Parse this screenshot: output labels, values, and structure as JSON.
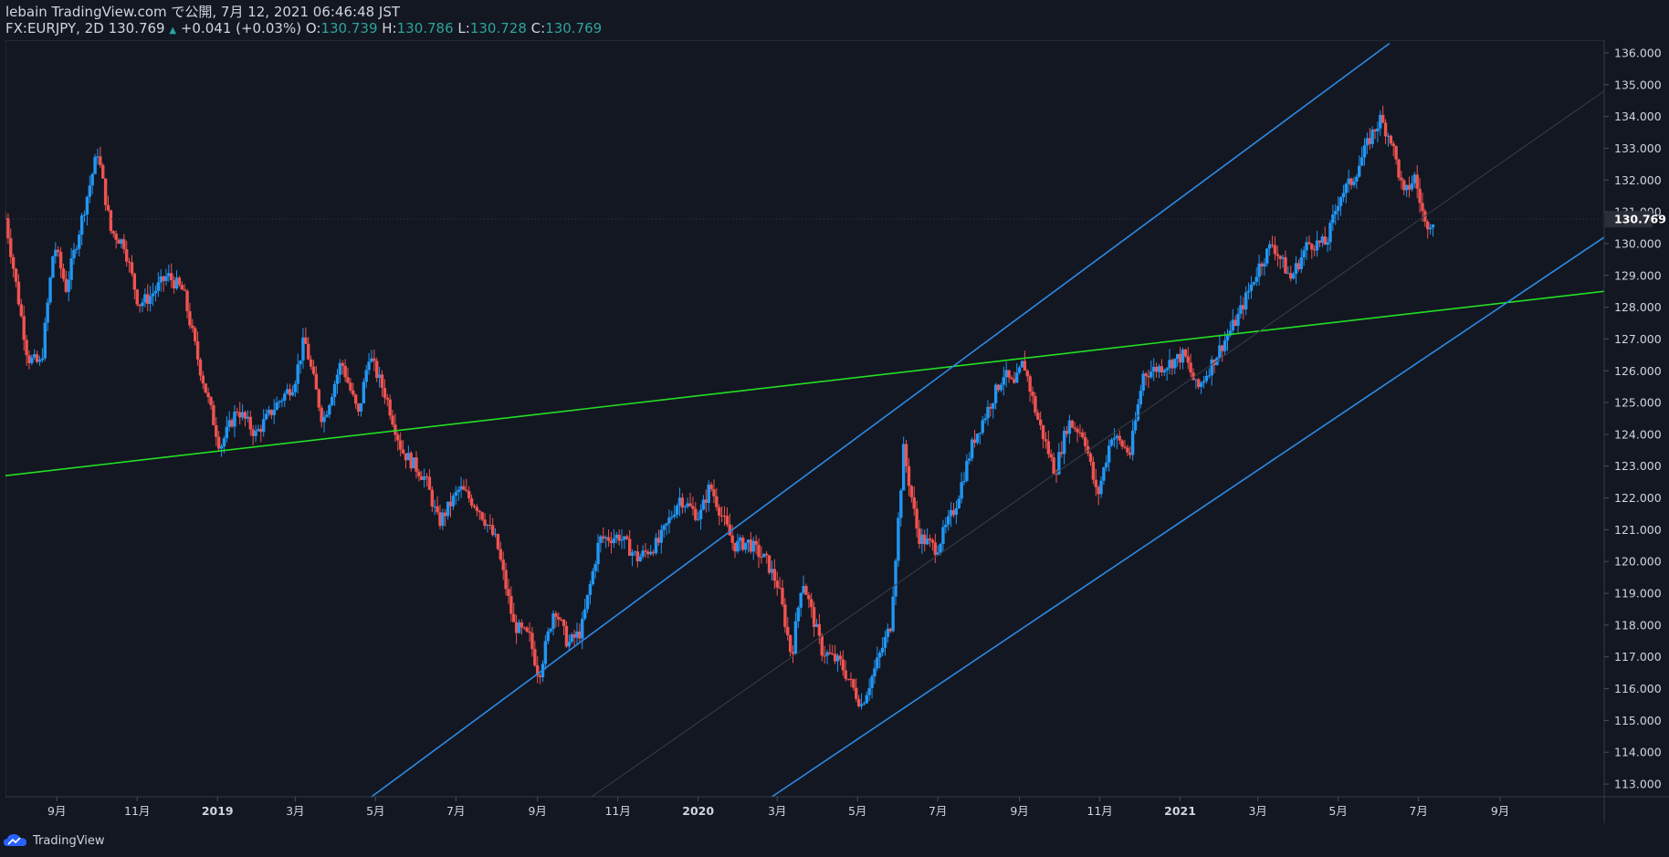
{
  "header": {
    "published": "lebain TradingView.com で公開, 7月 12, 2021 06:46:48 JST",
    "symbol": "FX:EURJPY, 2D",
    "last": "130.769",
    "change": "+0.041 (+0.03%)",
    "o_label": "O:",
    "o_value": "130.739",
    "h_label": "H:",
    "h_value": "130.786",
    "l_label": "L:",
    "l_value": "130.728",
    "c_label": "C:",
    "c_value": "130.769"
  },
  "footer": {
    "brand": "TradingView"
  },
  "colors": {
    "background": "#131722",
    "up": "#2196f3",
    "down": "#ef5350",
    "trendline_green": "#22e022",
    "channel_blue": "#2c8ae6",
    "grid": "#2a2e39",
    "axis_text": "#d1d4dc"
  },
  "chart_data": {
    "type": "candlestick",
    "symbol": "FX:EURJPY",
    "interval": "2D",
    "ylim": [
      112.6,
      136.4
    ],
    "y_ticks": [
      113,
      114,
      115,
      116,
      117,
      118,
      119,
      120,
      121,
      122,
      123,
      124,
      125,
      126,
      127,
      128,
      129,
      130,
      131,
      132,
      133,
      134,
      135,
      136
    ],
    "y_tick_labels": [
      "113.000",
      "114.000",
      "115.000",
      "116.000",
      "117.000",
      "118.000",
      "119.000",
      "120.000",
      "121.000",
      "122.000",
      "123.000",
      "124.000",
      "125.000",
      "126.000",
      "127.000",
      "128.000",
      "129.000",
      "130.000",
      "131.000",
      "132.000",
      "133.000",
      "134.000",
      "135.000",
      "136.000"
    ],
    "x_ticks": [
      {
        "label": "9月",
        "date": "2018-09-01"
      },
      {
        "label": "11月",
        "date": "2018-11-01"
      },
      {
        "label": "2019",
        "date": "2019-01-01"
      },
      {
        "label": "3月",
        "date": "2019-03-01"
      },
      {
        "label": "5月",
        "date": "2019-05-01"
      },
      {
        "label": "7月",
        "date": "2019-07-01"
      },
      {
        "label": "9月",
        "date": "2019-09-01"
      },
      {
        "label": "11月",
        "date": "2019-11-01"
      },
      {
        "label": "2020",
        "date": "2020-01-01"
      },
      {
        "label": "3月",
        "date": "2020-03-01"
      },
      {
        "label": "5月",
        "date": "2020-05-01"
      },
      {
        "label": "7月",
        "date": "2020-07-01"
      },
      {
        "label": "9月",
        "date": "2020-09-01"
      },
      {
        "label": "11月",
        "date": "2020-11-01"
      },
      {
        "label": "2021",
        "date": "2021-01-01"
      },
      {
        "label": "3月",
        "date": "2021-03-01"
      },
      {
        "label": "5月",
        "date": "2021-05-01"
      },
      {
        "label": "7月",
        "date": "2021-07-01"
      },
      {
        "label": "9月",
        "date": "2021-09-01"
      }
    ],
    "x_range": [
      "2018-07-24",
      "2021-11-19"
    ],
    "price_path": [
      {
        "date": "2018-07-24",
        "price": 130.8
      },
      {
        "date": "2018-08-10",
        "price": 126.4
      },
      {
        "date": "2018-08-20",
        "price": 126.2
      },
      {
        "date": "2018-08-30",
        "price": 130.0
      },
      {
        "date": "2018-09-08",
        "price": 128.6
      },
      {
        "date": "2018-09-24",
        "price": 131.5
      },
      {
        "date": "2018-10-02",
        "price": 132.9
      },
      {
        "date": "2018-10-12",
        "price": 130.4
      },
      {
        "date": "2018-10-22",
        "price": 130.0
      },
      {
        "date": "2018-11-02",
        "price": 128.1
      },
      {
        "date": "2018-11-10",
        "price": 128.3
      },
      {
        "date": "2018-11-24",
        "price": 129.0
      },
      {
        "date": "2018-12-06",
        "price": 128.5
      },
      {
        "date": "2018-12-18",
        "price": 126.2
      },
      {
        "date": "2019-01-03",
        "price": 123.6
      },
      {
        "date": "2019-01-16",
        "price": 124.8
      },
      {
        "date": "2019-01-30",
        "price": 124.0
      },
      {
        "date": "2019-02-14",
        "price": 124.9
      },
      {
        "date": "2019-02-28",
        "price": 125.6
      },
      {
        "date": "2019-03-08",
        "price": 127.0
      },
      {
        "date": "2019-03-22",
        "price": 124.4
      },
      {
        "date": "2019-04-05",
        "price": 126.3
      },
      {
        "date": "2019-04-18",
        "price": 124.6
      },
      {
        "date": "2019-04-26",
        "price": 126.5
      },
      {
        "date": "2019-05-09",
        "price": 125.2
      },
      {
        "date": "2019-05-21",
        "price": 123.5
      },
      {
        "date": "2019-06-08",
        "price": 122.6
      },
      {
        "date": "2019-06-18",
        "price": 121.2
      },
      {
        "date": "2019-07-04",
        "price": 122.3
      },
      {
        "date": "2019-07-18",
        "price": 121.7
      },
      {
        "date": "2019-08-01",
        "price": 120.6
      },
      {
        "date": "2019-08-14",
        "price": 118.0
      },
      {
        "date": "2019-08-26",
        "price": 117.6
      },
      {
        "date": "2019-09-02",
        "price": 116.4
      },
      {
        "date": "2019-09-14",
        "price": 118.6
      },
      {
        "date": "2019-09-24",
        "price": 117.4
      },
      {
        "date": "2019-10-04",
        "price": 117.8
      },
      {
        "date": "2019-10-18",
        "price": 120.7
      },
      {
        "date": "2019-11-02",
        "price": 120.8
      },
      {
        "date": "2019-11-16",
        "price": 120.1
      },
      {
        "date": "2019-12-02",
        "price": 120.6
      },
      {
        "date": "2019-12-18",
        "price": 122.0
      },
      {
        "date": "2020-01-02",
        "price": 121.4
      },
      {
        "date": "2020-01-10",
        "price": 122.4
      },
      {
        "date": "2020-01-28",
        "price": 120.5
      },
      {
        "date": "2020-02-08",
        "price": 120.6
      },
      {
        "date": "2020-02-22",
        "price": 120.0
      },
      {
        "date": "2020-03-02",
        "price": 119.2
      },
      {
        "date": "2020-03-12",
        "price": 117.0
      },
      {
        "date": "2020-03-20",
        "price": 119.5
      },
      {
        "date": "2020-04-04",
        "price": 117.2
      },
      {
        "date": "2020-04-18",
        "price": 116.8
      },
      {
        "date": "2020-05-04",
        "price": 115.5
      },
      {
        "date": "2020-05-14",
        "price": 116.6
      },
      {
        "date": "2020-05-26",
        "price": 118.0
      },
      {
        "date": "2020-06-05",
        "price": 123.5
      },
      {
        "date": "2020-06-16",
        "price": 120.8
      },
      {
        "date": "2020-06-30",
        "price": 120.4
      },
      {
        "date": "2020-07-14",
        "price": 121.7
      },
      {
        "date": "2020-07-28",
        "price": 123.8
      },
      {
        "date": "2020-08-08",
        "price": 124.8
      },
      {
        "date": "2020-08-20",
        "price": 125.9
      },
      {
        "date": "2020-08-28",
        "price": 125.5
      },
      {
        "date": "2020-09-04",
        "price": 126.3
      },
      {
        "date": "2020-09-14",
        "price": 124.6
      },
      {
        "date": "2020-09-28",
        "price": 122.8
      },
      {
        "date": "2020-10-08",
        "price": 124.4
      },
      {
        "date": "2020-10-20",
        "price": 124.0
      },
      {
        "date": "2020-10-30",
        "price": 122.0
      },
      {
        "date": "2020-11-10",
        "price": 124.0
      },
      {
        "date": "2020-11-24",
        "price": 123.4
      },
      {
        "date": "2020-12-04",
        "price": 125.9
      },
      {
        "date": "2020-12-22",
        "price": 126.2
      },
      {
        "date": "2021-01-04",
        "price": 126.5
      },
      {
        "date": "2021-01-14",
        "price": 125.4
      },
      {
        "date": "2021-01-30",
        "price": 126.6
      },
      {
        "date": "2021-02-14",
        "price": 127.7
      },
      {
        "date": "2021-03-02",
        "price": 129.3
      },
      {
        "date": "2021-03-12",
        "price": 130.0
      },
      {
        "date": "2021-03-26",
        "price": 128.9
      },
      {
        "date": "2021-04-08",
        "price": 130.0
      },
      {
        "date": "2021-04-22",
        "price": 130.0
      },
      {
        "date": "2021-05-02",
        "price": 131.5
      },
      {
        "date": "2021-05-12",
        "price": 132.0
      },
      {
        "date": "2021-05-26",
        "price": 133.4
      },
      {
        "date": "2021-06-02",
        "price": 133.9
      },
      {
        "date": "2021-06-10",
        "price": 133.3
      },
      {
        "date": "2021-06-20",
        "price": 131.5
      },
      {
        "date": "2021-06-28",
        "price": 132.1
      },
      {
        "date": "2021-07-06",
        "price": 130.6
      },
      {
        "date": "2021-07-12",
        "price": 130.77
      }
    ],
    "last_price": 130.769,
    "last_price_label": "130.769",
    "drawings": [
      {
        "type": "trendline",
        "color": "#22e022",
        "p1": {
          "date": "2018-07-24",
          "price": 122.7
        },
        "p2": {
          "date": "2021-11-19",
          "price": 128.5
        }
      },
      {
        "type": "channel_upper",
        "color": "#2c8ae6",
        "p1": {
          "date": "2019-04-28",
          "price": 112.6
        },
        "p2": {
          "date": "2021-06-09",
          "price": 136.3
        }
      },
      {
        "type": "channel_lower",
        "color": "#2c8ae6",
        "p1": {
          "date": "2020-02-26",
          "price": 112.6
        },
        "p2": {
          "date": "2021-11-19",
          "price": 130.2
        }
      },
      {
        "type": "channel_mid",
        "color": "#3a3e4a",
        "p1": {
          "date": "2019-10-12",
          "price": 112.6
        },
        "p2": {
          "date": "2021-11-19",
          "price": 134.8
        }
      }
    ]
  }
}
